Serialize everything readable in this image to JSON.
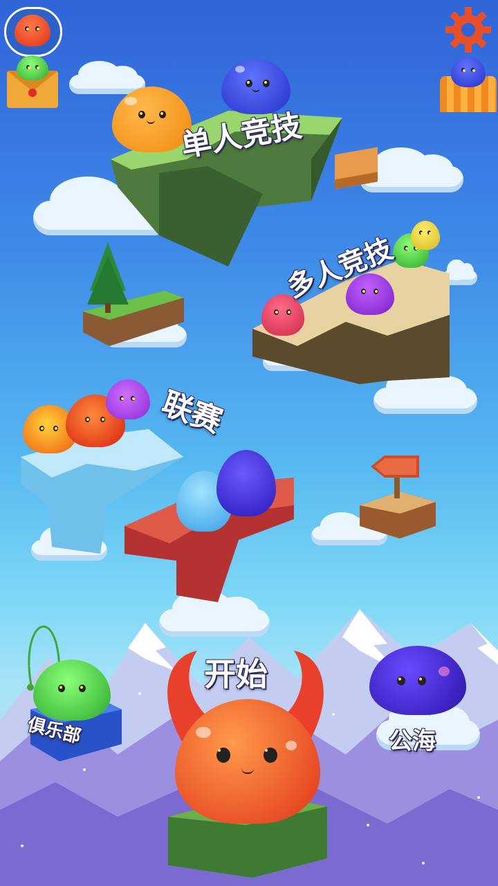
{
  "menu": {
    "solo_arena": "单人竞技",
    "multi_arena": "多人竞技",
    "league": "联赛",
    "start": "开始",
    "club": "俱乐部",
    "open_sea": "公海"
  },
  "icons": {
    "avatar": "red-slime-avatar-icon",
    "mail": "mail-envelope-icon",
    "settings": "gear-icon",
    "shop": "slime-shop-icon",
    "signpost": "arrow-signpost-icon"
  },
  "colors": {
    "sky_top": "#2f64d8",
    "sky_bottom": "#a9e4f8",
    "gear": "#e8502a",
    "text": "#ffffff"
  }
}
